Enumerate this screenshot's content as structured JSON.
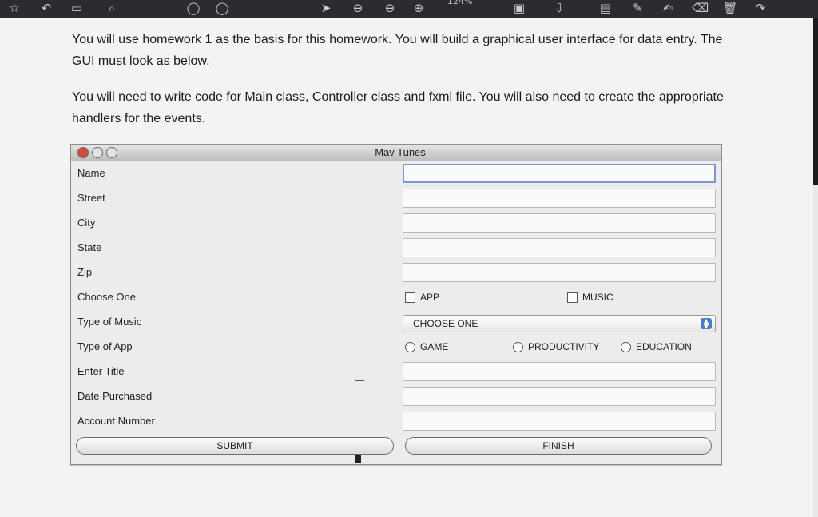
{
  "viewer": {
    "zoom": "124%",
    "icons": [
      "star-icon",
      "undo-icon",
      "inbox-icon",
      "search-icon",
      "circle-icon",
      "circle-icon",
      "pointer-icon",
      "circle-minus-icon",
      "circle-minus-icon",
      "circle-plus-icon",
      "page-icon",
      "download-icon",
      "comment-icon",
      "pen-icon",
      "signature-icon",
      "eraser-icon",
      "trash-icon",
      "redo-icon"
    ]
  },
  "instructions": {
    "para1": "You will use homework 1 as the basis for this homework. You will build a graphical user interface for data entry.  The GUI must look as below.",
    "para2": "You will need to write code for Main class, Controller class and fxml file. You will also need to create the appropriate handlers for the events."
  },
  "window": {
    "title": "Mav Tunes",
    "labels": {
      "name": "Name",
      "street": "Street",
      "city": "City",
      "state": "State",
      "zip": "Zip",
      "choose_one": "Choose One",
      "type_of_music": "Type of Music",
      "type_of_app": "Type of App",
      "enter_title": "Enter Title",
      "date_purchased": "Date Purchased",
      "account_number": "Account Number"
    },
    "fields": {
      "name": "",
      "street": "",
      "city": "",
      "state": "",
      "zip": "",
      "title": "",
      "date_purchased": "",
      "account_number": ""
    },
    "checkboxes": {
      "app": "APP",
      "music": "MUSIC"
    },
    "music_select": {
      "selected": "CHOOSE ONE"
    },
    "radios": {
      "game": "GAME",
      "productivity": "PRODUCTIVITY",
      "education": "EDUCATION"
    },
    "buttons": {
      "submit": "SUBMIT",
      "finish": "FINISH"
    }
  }
}
